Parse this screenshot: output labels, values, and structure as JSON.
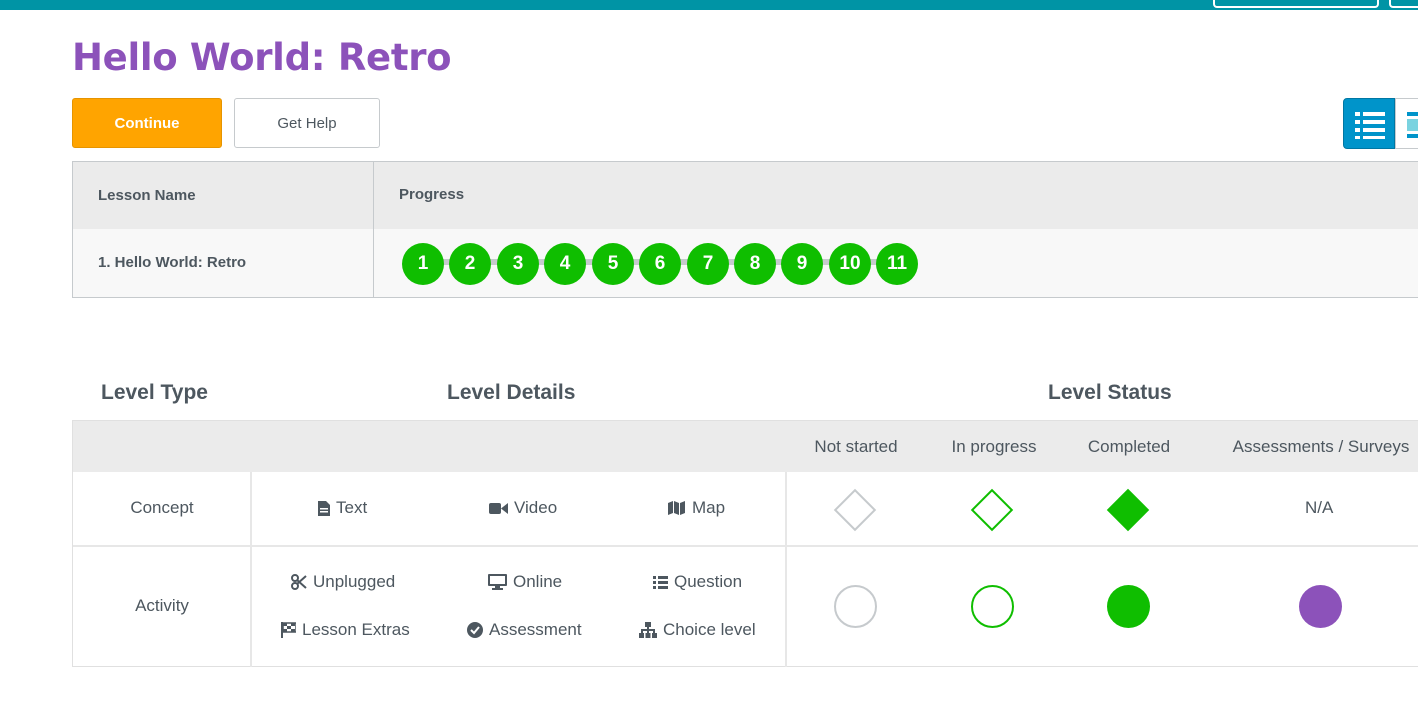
{
  "page": {
    "title": "Hello World: Retro"
  },
  "actions": {
    "continue_label": "Continue",
    "help_label": "Get Help"
  },
  "view_toggle": {
    "active": "list-view",
    "icons": [
      "list-view-icon",
      "grid-view-icon"
    ]
  },
  "progress_table": {
    "headers": [
      "Lesson Name",
      "Progress"
    ],
    "rows": [
      {
        "lesson": "1. Hello World: Retro",
        "levels": [
          "1",
          "2",
          "3",
          "4",
          "5",
          "6",
          "7",
          "8",
          "9",
          "10",
          "11"
        ],
        "level_status": "completed"
      }
    ]
  },
  "key": {
    "section_headers": {
      "level_type": "Level Type",
      "level_details": "Level Details",
      "level_status": "Level Status"
    },
    "status_columns": [
      "Not started",
      "In progress",
      "Completed",
      "Assessments / Surveys"
    ],
    "rows": {
      "concept": {
        "label": "Concept",
        "details": [
          {
            "icon": "file-icon",
            "label": "Text"
          },
          {
            "icon": "video-icon",
            "label": "Video"
          },
          {
            "icon": "map-icon",
            "label": "Map"
          }
        ],
        "assessment_value": "N/A"
      },
      "activity": {
        "label": "Activity",
        "details": [
          {
            "icon": "scissors-icon",
            "label": "Unplugged"
          },
          {
            "icon": "desktop-icon",
            "label": "Online"
          },
          {
            "icon": "list-icon",
            "label": "Question"
          },
          {
            "icon": "flag-checkered-icon",
            "label": "Lesson Extras"
          },
          {
            "icon": "check-circle-icon",
            "label": "Assessment"
          },
          {
            "icon": "sitemap-icon",
            "label": "Choice level"
          }
        ]
      }
    }
  },
  "colors": {
    "topbar": "#0094a5",
    "title": "#8c52ba",
    "continue": "#ffa400",
    "completed": "#0fbe00",
    "assessment": "#8c52ba",
    "not_started_border": "#c6cacd",
    "view_toggle_active": "#0094ca"
  }
}
